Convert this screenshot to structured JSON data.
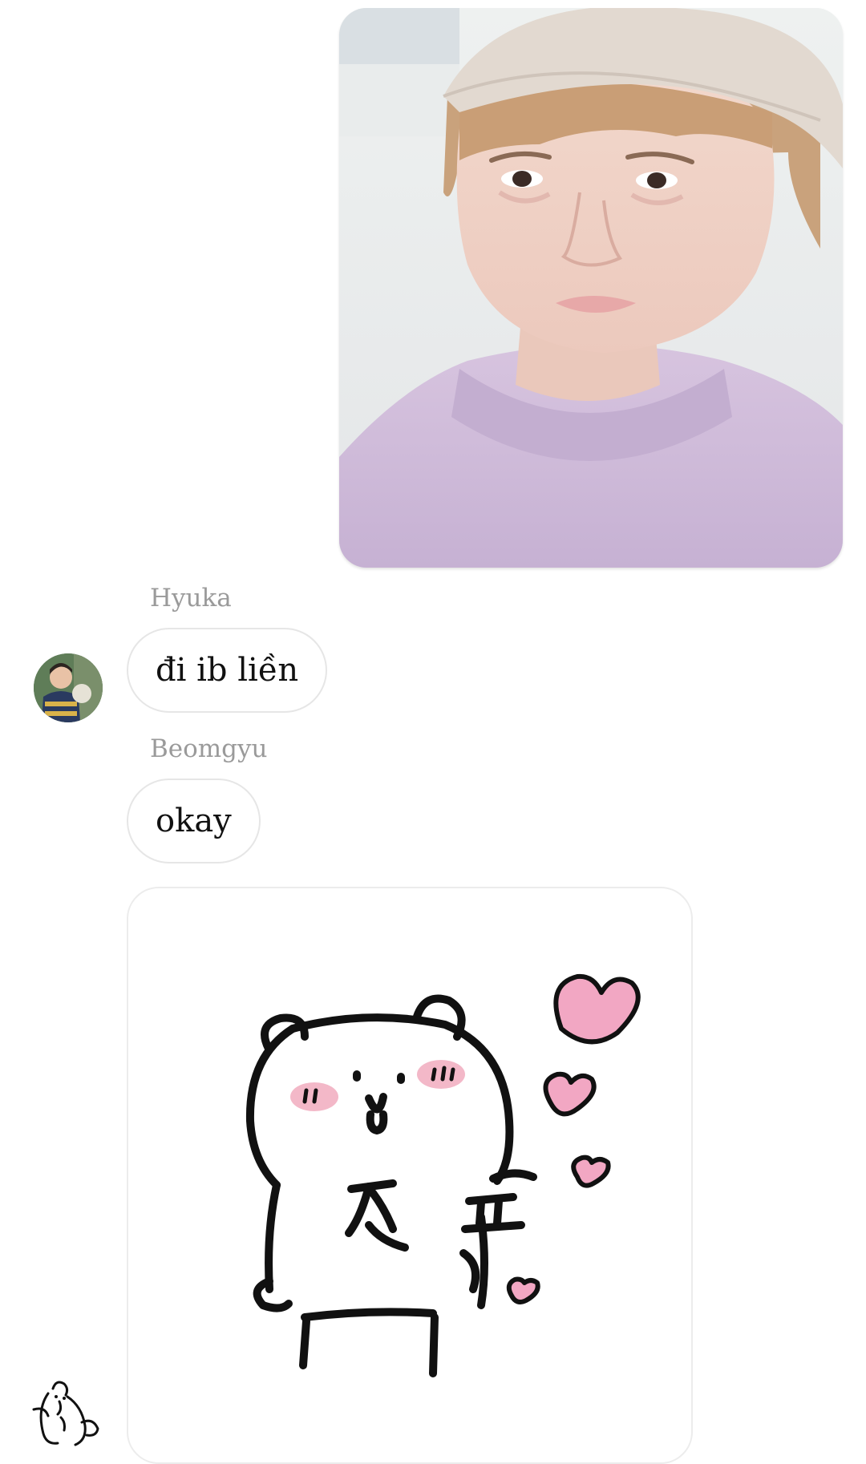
{
  "messages": [
    {
      "type": "image",
      "content": "photo",
      "sender": ""
    },
    {
      "type": "text",
      "sender": "Hyuka",
      "text": "đi ib liền"
    },
    {
      "type": "text",
      "sender": "Beomgyu",
      "text": "okay"
    },
    {
      "type": "sticker",
      "content": "bear-sticker",
      "sender": ""
    }
  ],
  "colors": {
    "bubble_border": "#e6e6e6",
    "sender_name": "#9a9a9a",
    "heart_pink": "#f2a7c3",
    "sweater_lavender": "#c9b3d6"
  }
}
